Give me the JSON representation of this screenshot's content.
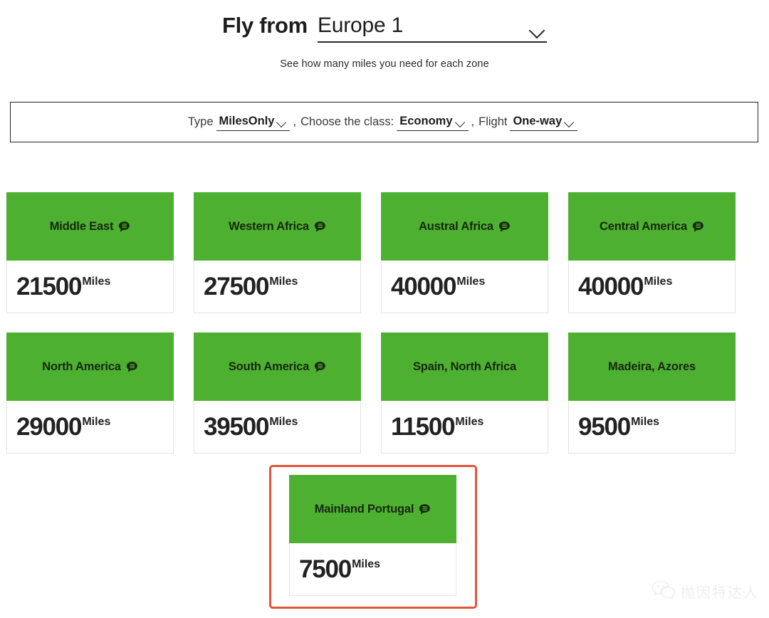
{
  "header": {
    "fly_from_label": "Fly from",
    "origin_value": "Europe 1",
    "origin_chevron_icon": "chevron-down-icon",
    "subtitle": "See how many miles you need for each zone"
  },
  "filters": {
    "type_label": "Type",
    "type_value": "MilesOnly",
    "class_label": "Choose the class:",
    "class_value": "Economy",
    "flight_label": "Flight",
    "flight_value": "One-way",
    "separator": ",",
    "chevron_icon": "chevron-down-icon"
  },
  "cards": [
    {
      "zone": "Middle East",
      "miles": "21500",
      "unit": "Miles",
      "has_info": true,
      "info_icon": "speech-bubble-info-icon"
    },
    {
      "zone": "Western Africa",
      "miles": "27500",
      "unit": "Miles",
      "has_info": true,
      "info_icon": "speech-bubble-info-icon"
    },
    {
      "zone": "Austral Africa",
      "miles": "40000",
      "unit": "Miles",
      "has_info": true,
      "info_icon": "speech-bubble-info-icon"
    },
    {
      "zone": "Central America",
      "miles": "40000",
      "unit": "Miles",
      "has_info": true,
      "info_icon": "speech-bubble-info-icon"
    },
    {
      "zone": "North America",
      "miles": "29000",
      "unit": "Miles",
      "has_info": true,
      "info_icon": "speech-bubble-info-icon"
    },
    {
      "zone": "South America",
      "miles": "39500",
      "unit": "Miles",
      "has_info": true,
      "info_icon": "speech-bubble-info-icon"
    },
    {
      "zone": "Spain, North Africa",
      "miles": "11500",
      "unit": "Miles",
      "has_info": false,
      "info_icon": ""
    },
    {
      "zone": "Madeira, Azores",
      "miles": "9500",
      "unit": "Miles",
      "has_info": false,
      "info_icon": ""
    }
  ],
  "highlighted_card": {
    "zone": "Mainland Portugal",
    "miles": "7500",
    "unit": "Miles",
    "has_info": true,
    "info_icon": "speech-bubble-info-icon"
  },
  "watermark": {
    "text": "抛因特达人",
    "icon": "wechat-icon"
  },
  "colors": {
    "zone_green": "#4eb031",
    "highlight_border": "#e1553b",
    "text_dark": "#1d1d1d",
    "card_border": "#e4e4e4"
  }
}
